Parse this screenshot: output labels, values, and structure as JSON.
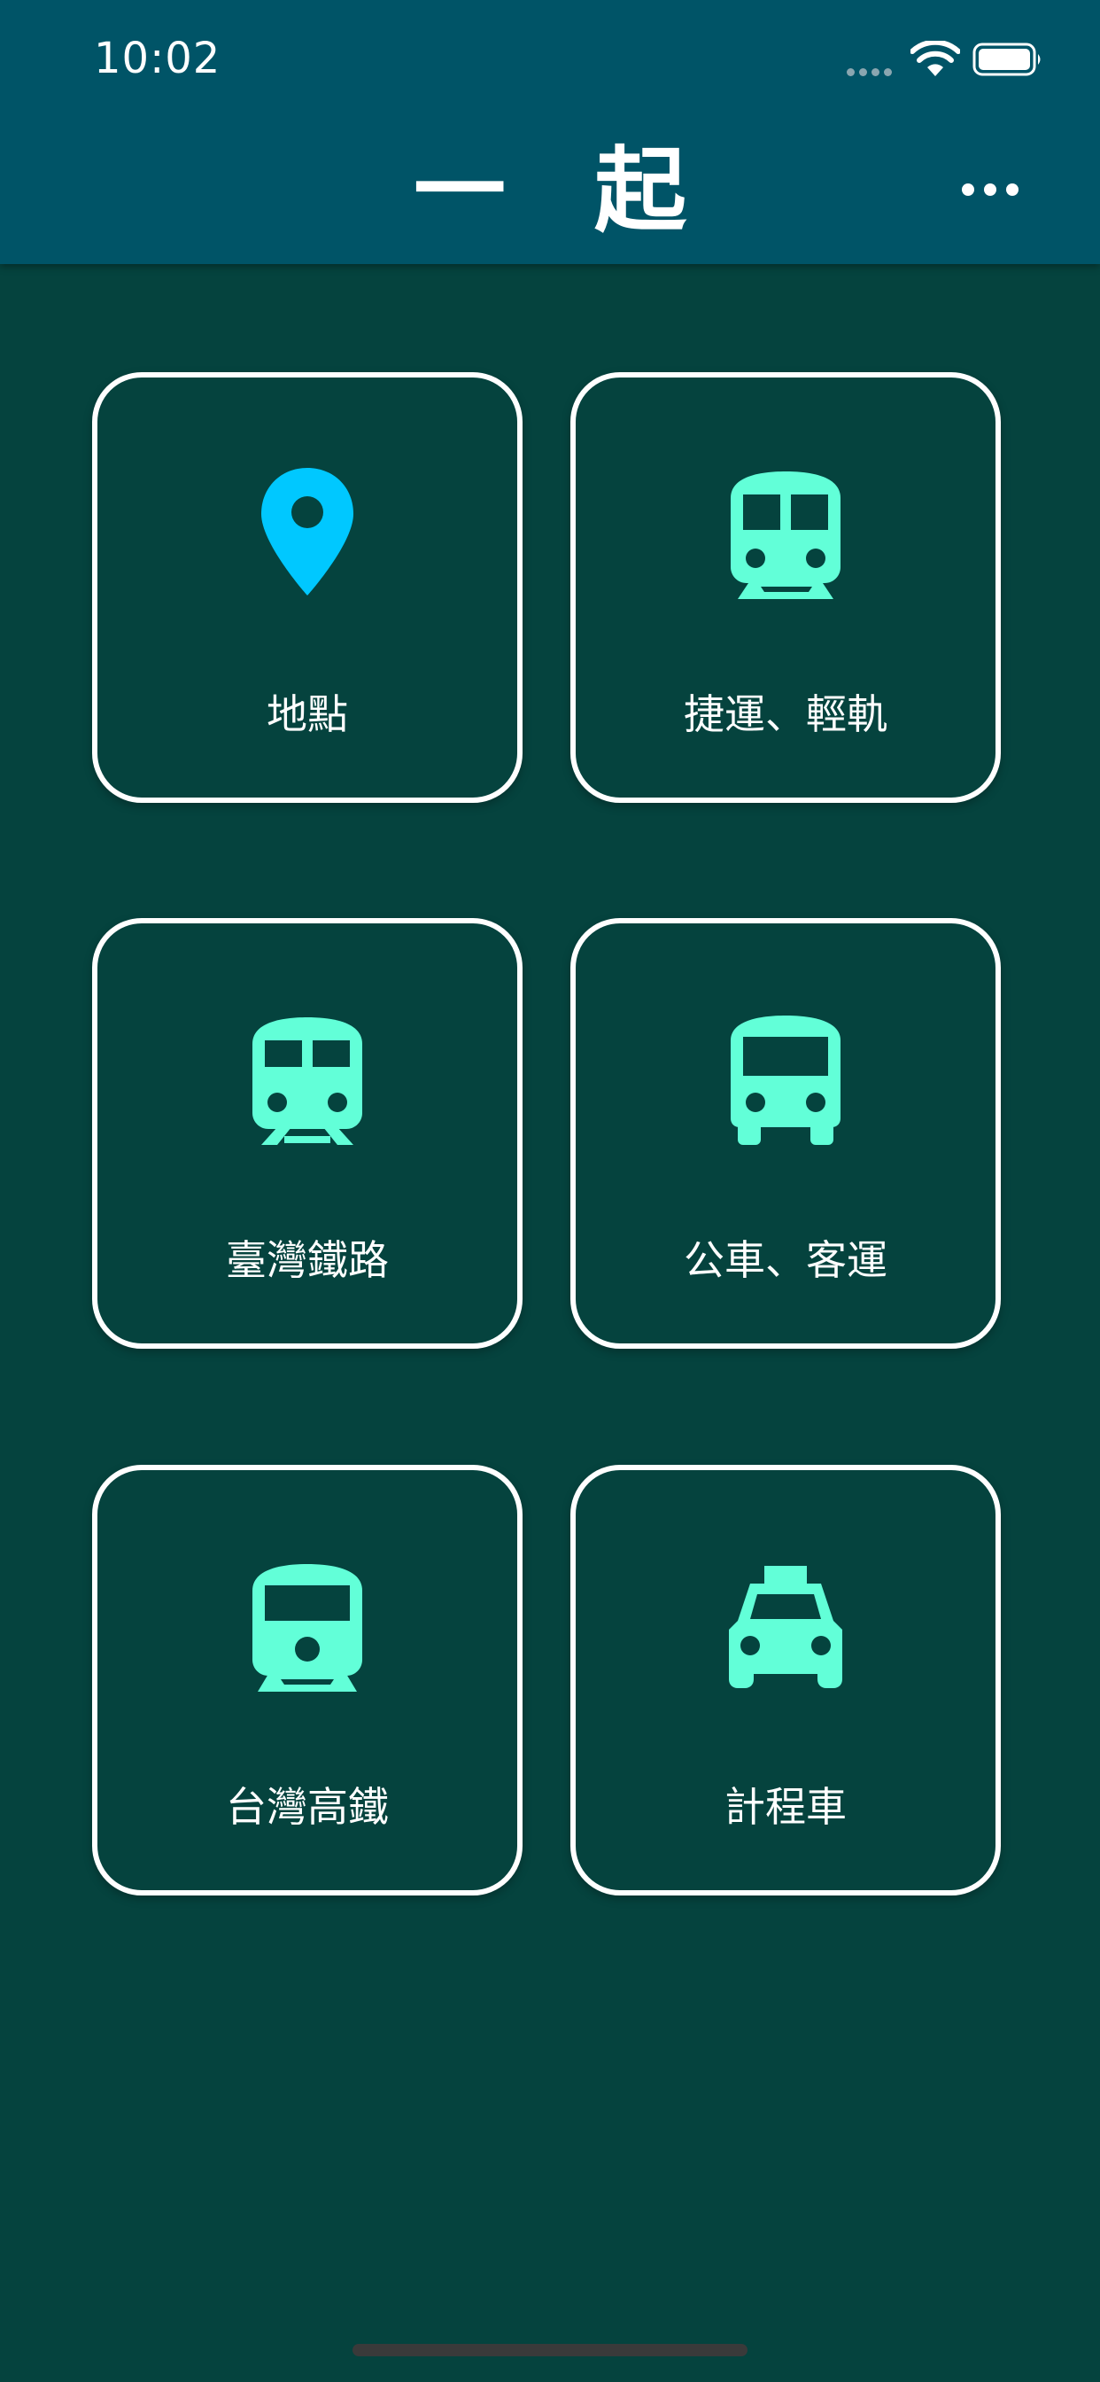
{
  "status_bar": {
    "time": "10:02"
  },
  "header": {
    "title": "一起"
  },
  "colors": {
    "header_bg": "#005467",
    "page_bg": "#05433e",
    "accent_pin": "#00c8ff",
    "accent_icon": "#62ffd8",
    "card_border": "#ffffff"
  },
  "menu": {
    "items": [
      {
        "label": "地點",
        "icon": "location-pin-icon"
      },
      {
        "label": "捷運、輕軌",
        "icon": "metro-icon"
      },
      {
        "label": "臺灣鐵路",
        "icon": "train-icon"
      },
      {
        "label": "公車、客運",
        "icon": "bus-icon"
      },
      {
        "label": "台灣高鐵",
        "icon": "high-speed-rail-icon"
      },
      {
        "label": "計程車",
        "icon": "taxi-icon"
      }
    ]
  }
}
